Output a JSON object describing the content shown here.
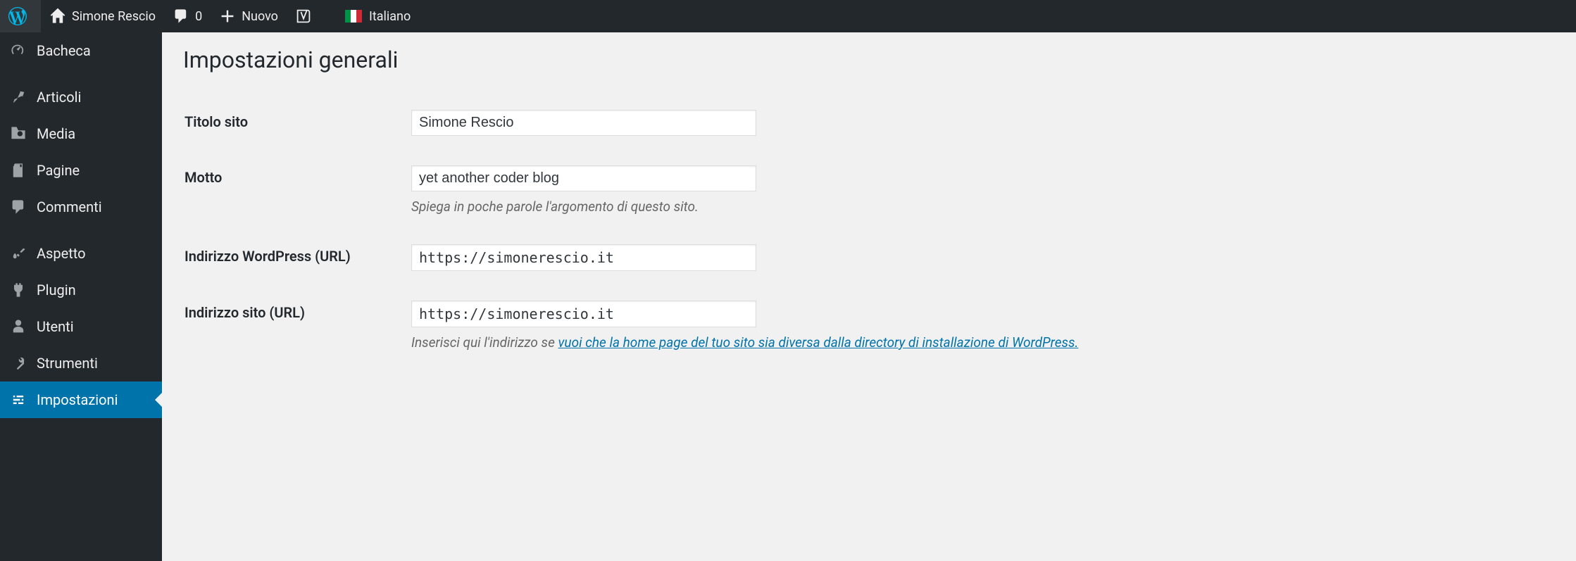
{
  "toolbar": {
    "site_name": "Simone Rescio",
    "comments_count": "0",
    "new_label": "Nuovo",
    "language_label": "Italiano"
  },
  "sidebar": {
    "items": [
      {
        "label": "Bacheca",
        "icon": "dashboard"
      },
      {
        "label": "Articoli",
        "icon": "pin"
      },
      {
        "label": "Media",
        "icon": "media"
      },
      {
        "label": "Pagine",
        "icon": "page"
      },
      {
        "label": "Commenti",
        "icon": "comment"
      },
      {
        "label": "Aspetto",
        "icon": "brush"
      },
      {
        "label": "Plugin",
        "icon": "plug"
      },
      {
        "label": "Utenti",
        "icon": "user"
      },
      {
        "label": "Strumenti",
        "icon": "wrench"
      },
      {
        "label": "Impostazioni",
        "icon": "sliders",
        "current": true
      }
    ]
  },
  "page": {
    "title": "Impostazioni generali",
    "fields": {
      "site_title": {
        "label": "Titolo sito",
        "value": "Simone Rescio"
      },
      "tagline": {
        "label": "Motto",
        "value": "yet another coder blog",
        "description": "Spiega in poche parole l'argomento di questo sito."
      },
      "wp_url": {
        "label": "Indirizzo WordPress (URL)",
        "value": "https://simonerescio.it"
      },
      "site_url": {
        "label": "Indirizzo sito (URL)",
        "value": "https://simonerescio.it",
        "description_prefix": "Inserisci qui l'indirizzo se ",
        "description_link": "vuoi che la home page del tuo sito sia diversa dalla directory di installazione di WordPress."
      }
    }
  }
}
